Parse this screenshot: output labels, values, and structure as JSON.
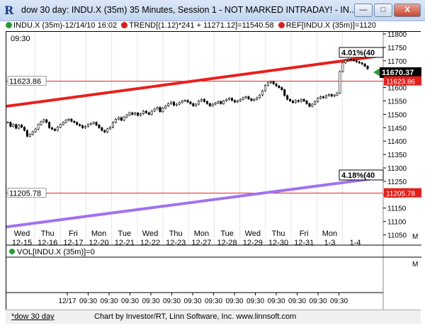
{
  "window": {
    "title": "dow 30 day: INDU.X (35m) 35 Minutes, Session 1 - NOT MARKED INTRADAY! - IN...",
    "min_label": "—",
    "max_label": "□",
    "close_label": "X"
  },
  "header": {
    "symbol": "INDU.X (35m)-12/14/10 16:02",
    "trend": "TREND[(1.12)*241 + 11271.12]=11540.58",
    "ref": "REF[INDU.X (35m)]=1120"
  },
  "price_panel": {
    "time_label": "09:30",
    "ref_upper": {
      "label": "11623.86",
      "value": 11623.86
    },
    "ref_lower": {
      "label": "11205.78",
      "value": 11205.78
    },
    "upper_channel_label": "4.01%(40",
    "lower_channel_label": "4.18%(40",
    "last_price_label": "11670.37",
    "axis_marker": "M"
  },
  "volume_panel": {
    "label": "VOL[INDU.X (35m)]=0",
    "axis_marker": "M"
  },
  "time_axis": {
    "labels": [
      "12/17",
      "09:30",
      "09:30",
      "09:30",
      "09:30",
      "09:30",
      "09:30",
      "09:30",
      "09:30",
      "09:30",
      "09:30",
      "09:30",
      "09:30",
      "09:30"
    ]
  },
  "footer": {
    "tab": "*dow 30 day",
    "credit": "Chart by Investor/RT, Linn Software, Inc. www.linnsoft.com"
  },
  "colors": {
    "upper_trend": "#e8201c",
    "lower_trend": "#a271f0",
    "ref_line": "#e0201c",
    "candle": "#000000",
    "last_price_arrow": "#2e9a3a"
  },
  "chart_data": {
    "type": "line",
    "title": "",
    "xlabel": "",
    "ylabel": "",
    "ylim": [
      11025,
      11800
    ],
    "yticks": [
      11050,
      11100,
      11150,
      11200,
      11250,
      11300,
      11350,
      11400,
      11450,
      11500,
      11550,
      11600,
      11650,
      11700,
      11750,
      11800
    ],
    "categories": [
      {
        "day": "Wed",
        "date": "12-15"
      },
      {
        "day": "Thu",
        "date": "12-16"
      },
      {
        "day": "Fri",
        "date": "12-17"
      },
      {
        "day": "Mon",
        "date": "12-20"
      },
      {
        "day": "Tue",
        "date": "12-21"
      },
      {
        "day": "Wed",
        "date": "12-22"
      },
      {
        "day": "Thu",
        "date": "12-23"
      },
      {
        "day": "Mon",
        "date": "12-27"
      },
      {
        "day": "Tue",
        "date": "12-28"
      },
      {
        "day": "Wed",
        "date": "12-29"
      },
      {
        "day": "Thu",
        "date": "12-30"
      },
      {
        "day": "Fri",
        "date": "12-31"
      },
      {
        "day": "Mon",
        "date": "1-3"
      },
      {
        "day": "",
        "date": "1-4"
      }
    ],
    "series": [
      {
        "values": [
          11470,
          11455,
          11462,
          11448,
          11460,
          11452,
          11440,
          11418,
          11425,
          11435,
          11445,
          11462,
          11472,
          11480,
          11470,
          11450,
          11445,
          11440,
          11452,
          11462,
          11470,
          11478,
          11482,
          11474,
          11470,
          11462,
          11458,
          11450,
          11455,
          11462,
          11466,
          11470,
          11460,
          11450,
          11440,
          11434,
          11446,
          11452,
          11470,
          11482,
          11488,
          11478,
          11490,
          11498,
          11506,
          11500,
          11505,
          11496,
          11502,
          11512,
          11506,
          11500,
          11512,
          11520,
          11526,
          11510,
          11524,
          11532,
          11540,
          11546,
          11534,
          11538,
          11544,
          11550,
          11552,
          11546,
          11540,
          11532,
          11538,
          11550,
          11556,
          11548,
          11540,
          11532,
          11538,
          11542,
          11548,
          11540,
          11550,
          11556,
          11560,
          11552,
          11546,
          11550,
          11556,
          11562,
          11566,
          11558,
          11552,
          11556,
          11562,
          11572,
          11588,
          11608,
          11618,
          11622,
          11614,
          11606,
          11600,
          11592,
          11570,
          11556,
          11550,
          11544,
          11552,
          11548,
          11556,
          11550,
          11540,
          11530,
          11538,
          11548,
          11560,
          11566,
          11562,
          11570,
          11574,
          11568,
          11572,
          11580,
          11660,
          11692,
          11702,
          11706,
          11704,
          11700,
          11696,
          11692,
          11688,
          11680,
          11670
        ]
      }
    ],
    "trend_lines": [
      {
        "start": 11530,
        "end": 11720
      },
      {
        "start": 11080,
        "end": 11265
      }
    ]
  }
}
